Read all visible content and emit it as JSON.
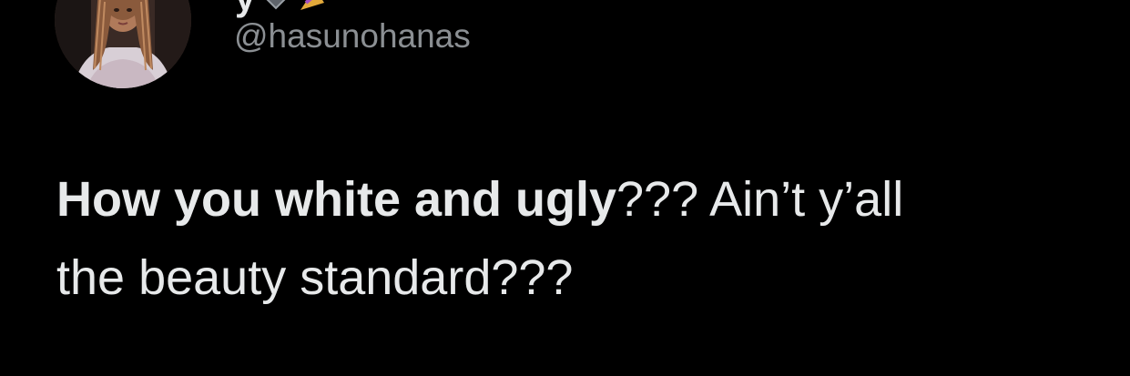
{
  "tweet": {
    "author": {
      "display_name_fragment": "y",
      "handle": "@hasunohanas",
      "avatar_icon": "profile-avatar",
      "name_emojis": [
        "diamond-icon",
        "party-popper-icon"
      ]
    },
    "text": {
      "bold_part": "How you white and ugly",
      "rest_line1": "??? Ain’t y’all",
      "line2": "the beauty standard???"
    },
    "colors": {
      "background": "#000000",
      "text": "#e7e9ea",
      "handle": "#8b8f93"
    }
  }
}
